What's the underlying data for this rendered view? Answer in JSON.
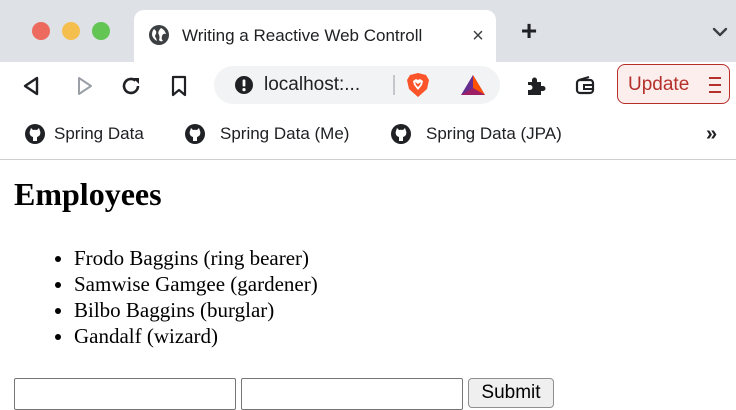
{
  "window": {
    "controls": [
      "close-dot",
      "minimize-dot",
      "zoom-dot"
    ]
  },
  "tab": {
    "icon": "globe-icon",
    "title": "Writing a Reactive Web Controll",
    "close_label": "×"
  },
  "tabstrip": {
    "new_tab_label": "+"
  },
  "toolbar": {
    "icons": [
      "back-icon",
      "forward-icon",
      "reload-icon",
      "bookmark-icon"
    ],
    "url": "localhost:...",
    "update_label": "Update",
    "extension_icons": [
      "brave-shields-icon",
      "brave-rewards-icon",
      "extensions-puzzle-icon",
      "wallet-icon"
    ]
  },
  "bookmarks": {
    "items": [
      {
        "label": "Spring Data",
        "icon": "github-icon"
      },
      {
        "label": "Spring Data (Me)",
        "icon": "github-icon"
      },
      {
        "label": "Spring Data (JPA)",
        "icon": "github-icon"
      }
    ],
    "more_label": "»"
  },
  "page": {
    "title": "Employees",
    "employees": [
      "Frodo Baggins (ring bearer)",
      "Samwise Gamgee (gardener)",
      "Bilbo Baggins (burglar)",
      "Gandalf (wizard)"
    ],
    "form": {
      "name_value": "",
      "role_value": "",
      "submit_label": "Submit"
    }
  },
  "colors": {
    "tabstrip_bg": "#dee1e6",
    "update_accent": "#b5302a",
    "brave_orange": "#fb542b"
  }
}
